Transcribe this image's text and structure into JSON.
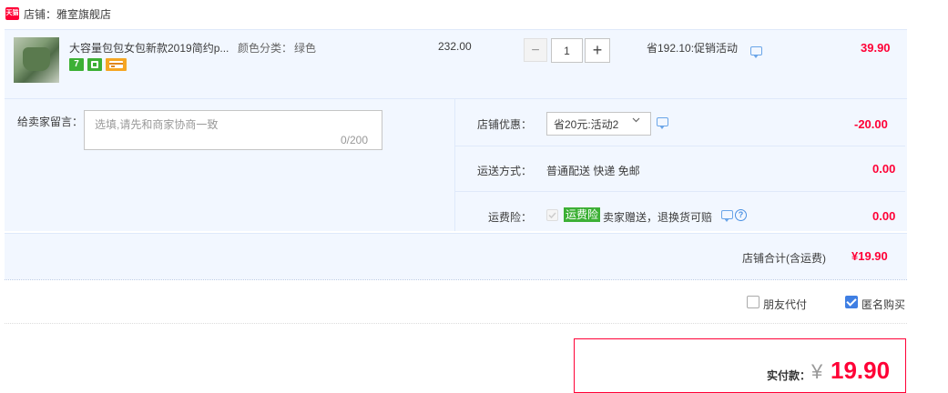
{
  "shop": {
    "badge": "天猫",
    "name": "店铺：雅室旗舰店"
  },
  "item": {
    "title": "大容量包包女包新款2019简约p...",
    "sku_label": "颜色分类：",
    "sku_value": "绿色",
    "badge_seven": "7",
    "badge_shield": "",
    "badge_card": "",
    "price": "232.00",
    "qty_minus": "−",
    "qty": "1",
    "qty_plus": "+",
    "promo": "省192.10:促销活动",
    "total": "39.90"
  },
  "message": {
    "label": "给卖家留言：",
    "placeholder": "选填,请先和商家协商一致",
    "count": "0/200"
  },
  "discount": {
    "label": "店铺优惠：",
    "selected": "省20元:活动2",
    "amount": "-20.00"
  },
  "shipping": {
    "label": "运送方式：",
    "value": "普通配送 快递 免邮",
    "amount": "0.00"
  },
  "insurance": {
    "label": "运费险：",
    "badge": "运费险",
    "text": "卖家赠送，退换货可赔",
    "help": "?",
    "amount": "0.00"
  },
  "subtotal": {
    "label": "店铺合计(含运费)",
    "amount": "¥19.90"
  },
  "options": {
    "friend_pay": "朋友代付",
    "anonymous": "匿名购买"
  },
  "payment": {
    "label": "实付款：",
    "currency": "¥",
    "amount": "19.90"
  },
  "colors": {
    "accent_red": "#ff0036",
    "panel_bg": "#f2f7ff",
    "green_badge": "#3cb035",
    "blue_check": "#3f7fe3"
  }
}
